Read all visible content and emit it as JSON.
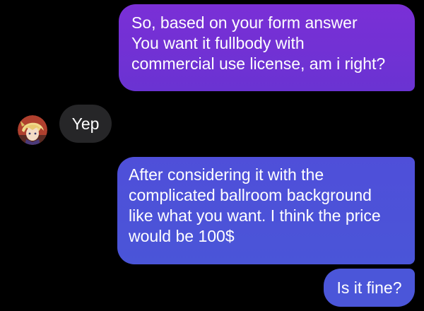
{
  "conversation": {
    "messages": [
      {
        "sender": "me",
        "lines": [
          "So, based on your form answer",
          "You want it fullbody with",
          "commercial use license, am i right?"
        ]
      },
      {
        "sender": "them",
        "lines": [
          "Yep"
        ]
      },
      {
        "sender": "me",
        "lines": [
          "After considering it with the",
          "complicated ballroom background",
          "like what you want. I think the price",
          "would be 100$"
        ]
      },
      {
        "sender": "me",
        "lines": [
          "Is it fine?"
        ]
      }
    ]
  },
  "contact": {
    "avatar_icon": "avatar-icon"
  },
  "colors": {
    "background": "#000000",
    "outgoing_purple": "#7a2fd6",
    "outgoing_blue": "#4b56d9",
    "incoming_gray": "#262628",
    "text": "#ffffff"
  }
}
